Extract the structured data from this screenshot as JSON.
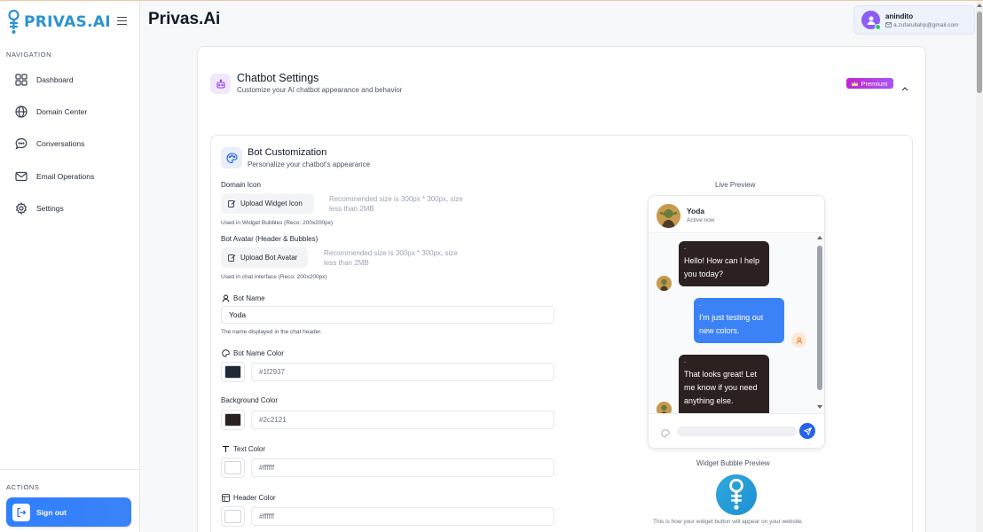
{
  "app": {
    "logo_text": "PRIVAS.AI",
    "page_title": "Privas.Ai"
  },
  "sidebar": {
    "nav_label": "NAVIGATION",
    "items": [
      {
        "label": "Dashboard",
        "icon": "grid-icon"
      },
      {
        "label": "Domain Center",
        "icon": "globe-icon"
      },
      {
        "label": "Conversations",
        "icon": "chat-icon"
      },
      {
        "label": "Email Operations",
        "icon": "mail-icon"
      },
      {
        "label": "Settings",
        "icon": "gear-icon"
      }
    ],
    "actions_label": "ACTIONS",
    "signout_label": "Sign out"
  },
  "user": {
    "name": "anindito",
    "email": "a.zufarullahp@gmail.com"
  },
  "chatbot_settings": {
    "title": "Chatbot Settings",
    "subtitle": "Customize your AI chatbot appearance and behavior",
    "badge": "Premium"
  },
  "bot_customization": {
    "title": "Bot Customization",
    "subtitle": "Personalize your chatbot's appearance",
    "domain_icon": {
      "label": "Domain Icon",
      "button": "Upload Widget Icon",
      "hint_line1": "Recommended size is 300px * 300px, size",
      "hint_line2": "less than 2MB",
      "note": "Used in Widget Bubbles (Reco: 200x200px)"
    },
    "bot_avatar": {
      "label": "Bot Avatar (Header & Bubbles)",
      "button": "Upload Bot Avatar",
      "hint_line1": "Recommended size is 300px * 300px, size",
      "hint_line2": "less than 2MB",
      "note": "Used in chat interface (Reco: 200x200px)"
    },
    "bot_name": {
      "label": "Bot Name",
      "value": "Yoda",
      "note": "The name displayed in the chat header."
    },
    "bot_name_color": {
      "label": "Bot Name Color",
      "value": "#1f2937",
      "swatch": "#1f2937"
    },
    "background_color": {
      "label": "Background Color",
      "value": "#2c2121",
      "swatch": "#2c2121"
    },
    "text_color": {
      "label": "Text Color",
      "value": "#ffffff",
      "swatch": "#ffffff"
    },
    "header_color": {
      "label": "Header Color",
      "value": "#ffffff",
      "swatch": "#ffffff"
    }
  },
  "preview": {
    "label": "Live Preview",
    "bot_name": "Yoda",
    "bot_status": "Active now",
    "messages": [
      {
        "from": "bot",
        "meta": "-",
        "text": "Hello! How can I help you today?"
      },
      {
        "from": "user",
        "meta": "-",
        "text": "I'm just testing out new colors."
      },
      {
        "from": "bot",
        "meta": "-",
        "text": "That looks great! Let me know if you need anything else."
      }
    ],
    "widget_label": "Widget Bubble Preview",
    "widget_note": "This is how your widget button will appear on your website."
  }
}
